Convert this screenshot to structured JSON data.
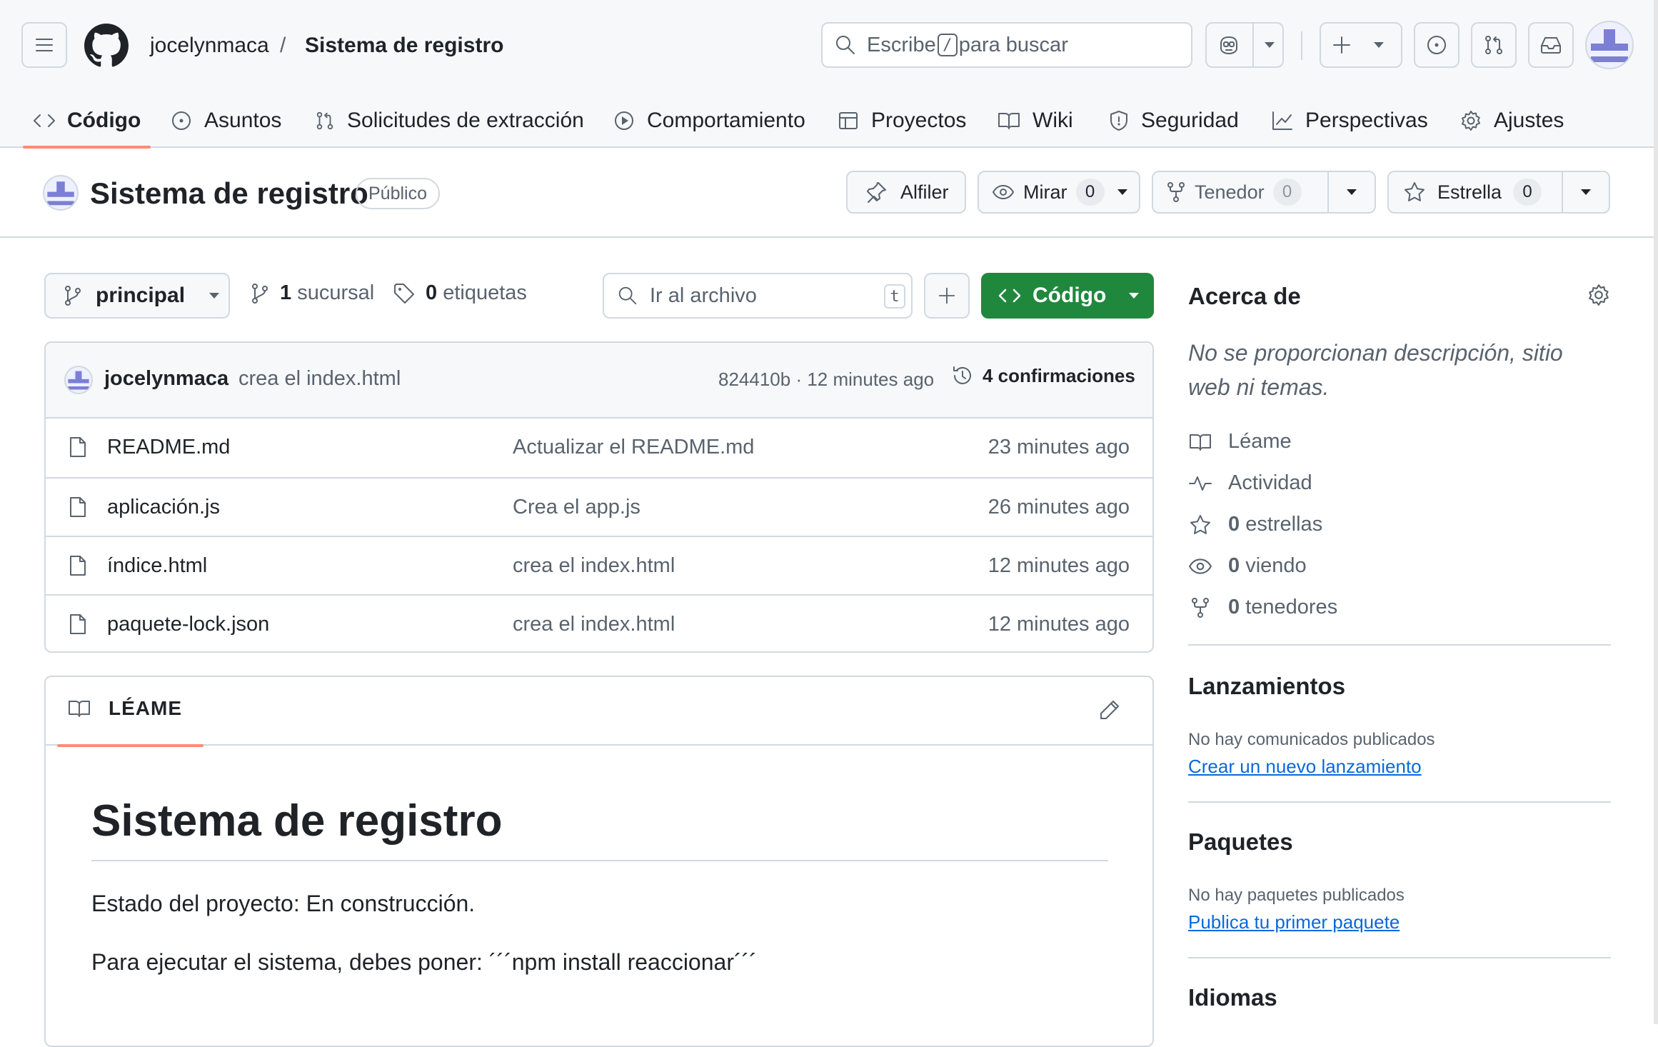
{
  "header": {
    "owner": "jocelynmaca",
    "separator": "/",
    "repo": "Sistema de registro",
    "search": {
      "prefix": "Escribe",
      "key": "/",
      "suffix": "para buscar"
    },
    "icons": [
      "hamburger-icon",
      "github-logo-icon",
      "search-icon",
      "copilot-icon",
      "plus-icon",
      "issues-icon",
      "pull-requests-icon",
      "inbox-icon",
      "avatar"
    ]
  },
  "tabs": [
    {
      "label": "Código",
      "icon": "code-icon",
      "active": true
    },
    {
      "label": "Asuntos",
      "icon": "issues-icon"
    },
    {
      "label": "Solicitudes de extracción",
      "icon": "pull-request-icon"
    },
    {
      "label": "Comportamiento",
      "icon": "actions-play-icon"
    },
    {
      "label": "Proyectos",
      "icon": "table-icon"
    },
    {
      "label": "Wiki",
      "icon": "book-icon"
    },
    {
      "label": "Seguridad",
      "icon": "shield-icon"
    },
    {
      "label": "Perspectivas",
      "icon": "graph-icon"
    },
    {
      "label": "Ajustes",
      "icon": "gear-icon"
    }
  ],
  "repo_bar": {
    "title": "Sistema de registro",
    "visibility": "Público",
    "pin_label": "Alfiler",
    "watch_label": "Mirar",
    "watch_count": "0",
    "fork_label": "Tenedor",
    "fork_count": "0",
    "star_label": "Estrella",
    "star_count": "0"
  },
  "toolbar": {
    "branch": "principal",
    "branches_count": "1",
    "branches_label": "sucursal",
    "tags_count": "0",
    "tags_label": "etiquetas",
    "goto_placeholder": "Ir al archivo",
    "goto_key": "t",
    "code_label": "Código"
  },
  "commit": {
    "author": "jocelynmaca",
    "message": "crea el index.html",
    "meta": "824410b · 12 minutes ago",
    "count_label": "4 confirmaciones"
  },
  "files": [
    {
      "name": "README.md",
      "commit": "Actualizar el README.md",
      "time": "23 minutes ago"
    },
    {
      "name": "aplicación.js",
      "commit": "Crea el app.js",
      "time": "26 minutes ago"
    },
    {
      "name": "índice.html",
      "commit": "crea el index.html",
      "time": "12 minutes ago"
    },
    {
      "name": "paquete-lock.json",
      "commit": "crea el index.html",
      "time": "12 minutes ago"
    }
  ],
  "readme": {
    "tab": "LÉAME",
    "h1": "Sistema de registro",
    "p1": "Estado del proyecto: En construcción.",
    "p2": "Para ejecutar el sistema, debes poner: ´´´npm install reaccionar´´´"
  },
  "sidebar": {
    "about_title": "Acerca de",
    "about_desc": "No se proporcionan descripción, sitio web ni temas.",
    "readme_link": "Léame",
    "activity_link": "Actividad",
    "stars_count": "0",
    "stars_label": "estrellas",
    "watching_count": "0",
    "watching_label": "viendo",
    "forks_count": "0",
    "forks_label": "tenedores",
    "releases_title": "Lanzamientos",
    "releases_note": "No hay comunicados publicados",
    "releases_link": "Crear un nuevo lanzamiento",
    "packages_title": "Paquetes",
    "packages_note": "No hay paquetes publicados",
    "packages_link": "Publica tu primer paquete",
    "languages_title": "Idiomas"
  },
  "colors": {
    "accent_green": "#1f883d",
    "tab_underline": "#fd8c73",
    "link": "#0969da",
    "border": "#d1d9e0"
  }
}
